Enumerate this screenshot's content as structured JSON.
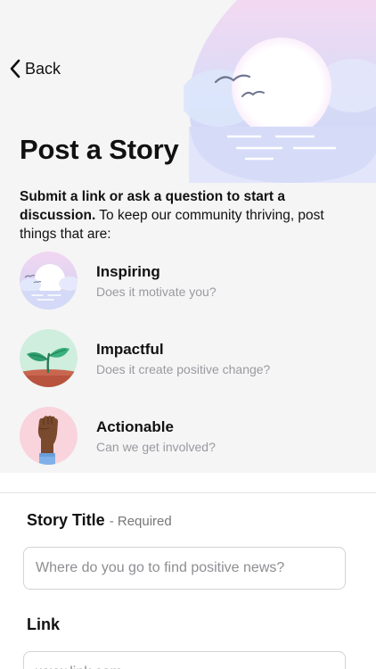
{
  "nav": {
    "back_label": "Back"
  },
  "page": {
    "title": "Post a Story",
    "intro_bold": "Submit a link or ask a question to start a discussion.",
    "intro_rest": " To keep our community thriving, post things that are:"
  },
  "criteria": [
    {
      "name": "Inspiring",
      "description": "Does it motivate you?"
    },
    {
      "name": "Impactful",
      "description": "Does it create positive change?"
    },
    {
      "name": "Actionable",
      "description": "Can we get involved?"
    }
  ],
  "form": {
    "story_title_label": "Story Title",
    "story_title_required": "- Required",
    "story_title_placeholder": "Where do you go to find positive news?",
    "link_label": "Link",
    "link_placeholder": "www.link.com"
  },
  "colors": {
    "background": "#f5f5f6",
    "text": "#111111",
    "secondary_text": "#9a9a9f",
    "input_border": "#d3d3d6"
  },
  "icons": [
    "chevron-left-icon",
    "sunrise-illustration",
    "seedling-illustration",
    "raised-fist-illustration"
  ]
}
